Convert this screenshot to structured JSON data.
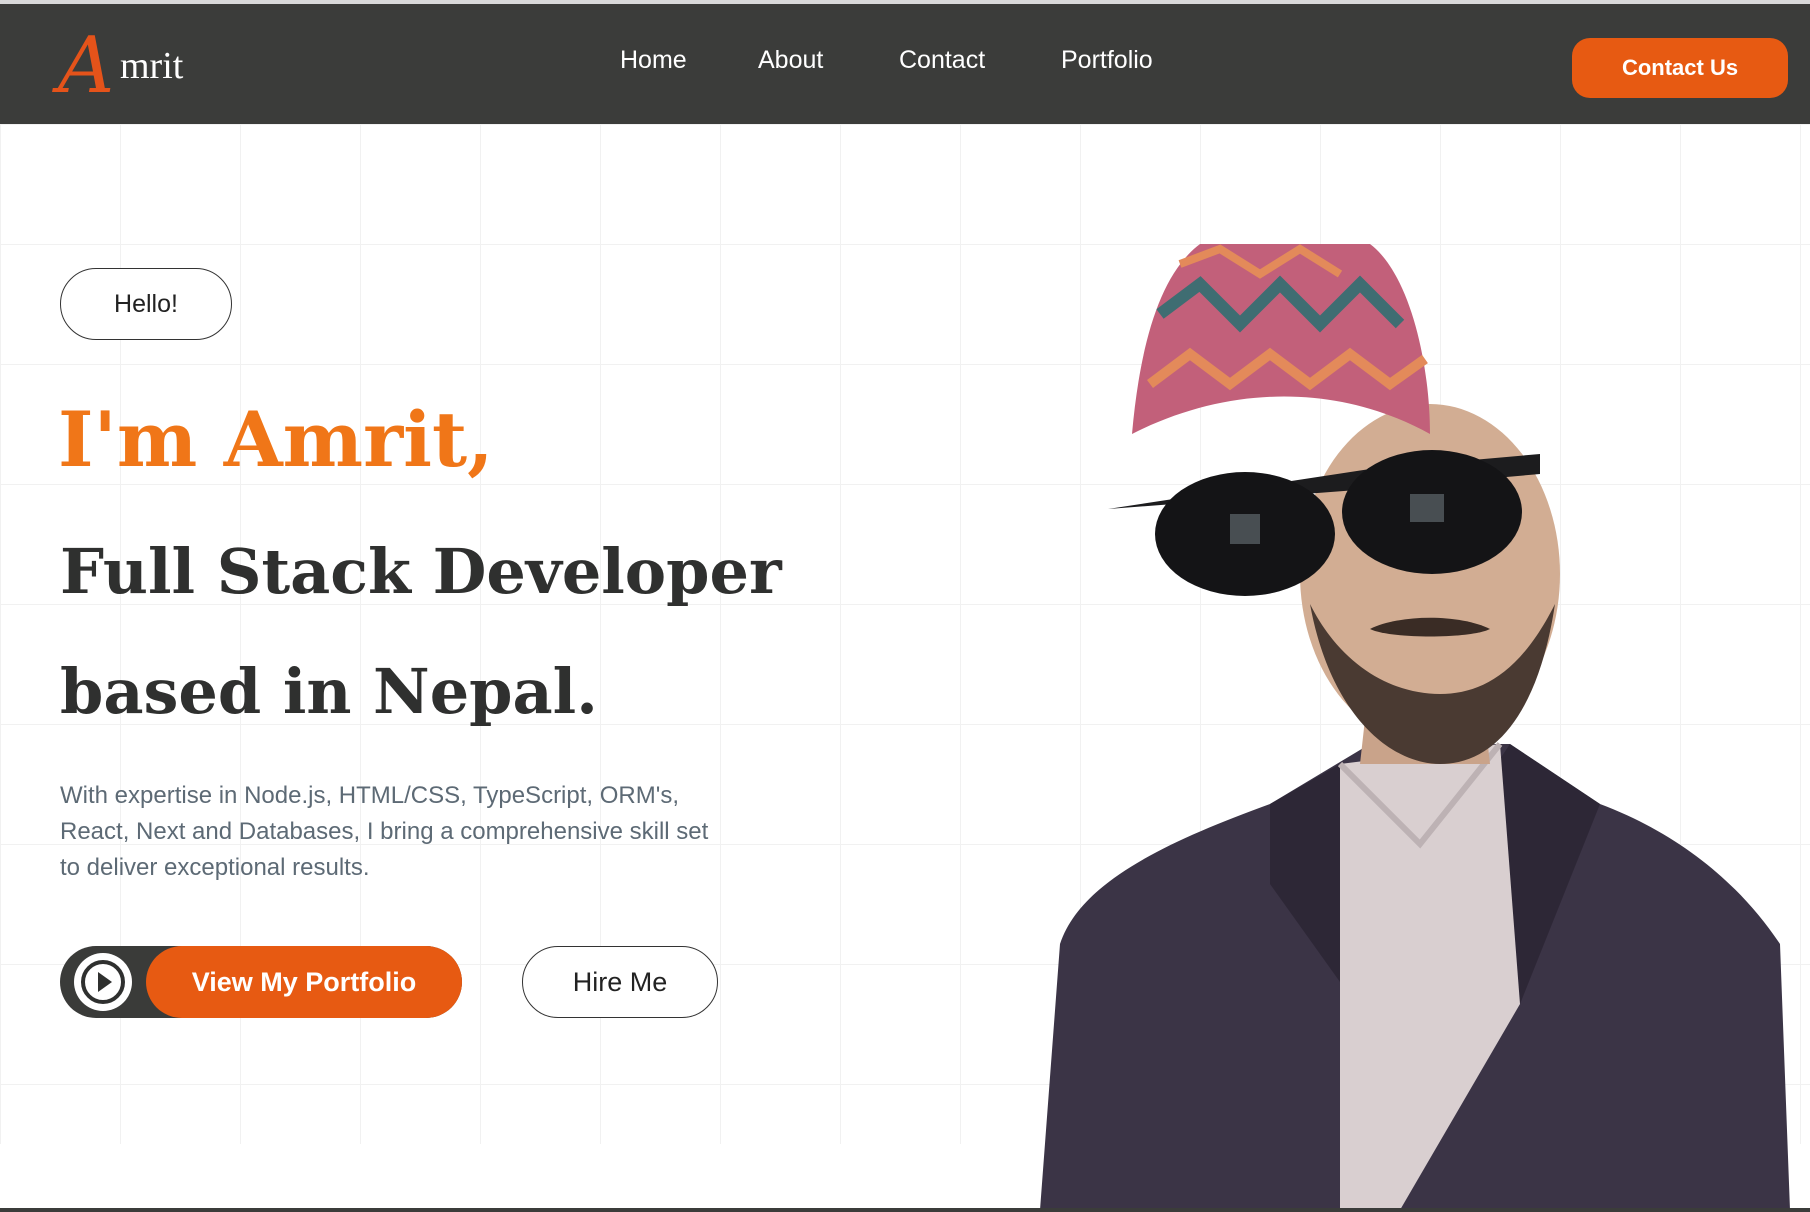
{
  "brand": {
    "initial": "A",
    "rest": "mrit"
  },
  "nav": {
    "links": [
      "Home",
      "About",
      "Contact",
      "Portfolio"
    ],
    "cta": "Contact Us"
  },
  "hero": {
    "greeting": "Hello!",
    "intro": "I'm Amrit,",
    "role": "Full Stack Developer",
    "location": "based in Nepal.",
    "description": "With expertise in Node.js, HTML/CSS, TypeScript, ORM's, React, Next and Databases, I bring a comprehensive skill set to deliver exceptional results.",
    "primary_button": "View My Portfolio",
    "secondary_button": "Hire Me"
  },
  "icons": {
    "play": "play-icon",
    "portrait": "profile-photo"
  },
  "colors": {
    "nav_bg": "#3b3c3a",
    "accent": "#e75a12",
    "intro_orange": "#f07618",
    "heading_dark": "#2f302f",
    "body_text": "#5d6a75"
  }
}
